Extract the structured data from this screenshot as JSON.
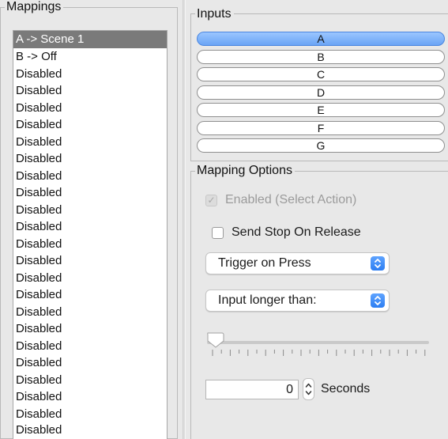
{
  "mappings": {
    "title": "Mappings",
    "items": [
      "A -> Scene 1",
      "B -> Off",
      "Disabled",
      "Disabled",
      "Disabled",
      "Disabled",
      "Disabled",
      "Disabled",
      "Disabled",
      "Disabled",
      "Disabled",
      "Disabled",
      "Disabled",
      "Disabled",
      "Disabled",
      "Disabled",
      "Disabled",
      "Disabled",
      "Disabled",
      "Disabled",
      "Disabled",
      "Disabled",
      "Disabled",
      "Disabled"
    ],
    "selected_index": 0
  },
  "inputs": {
    "title": "Inputs",
    "items": [
      "A",
      "B",
      "C",
      "D",
      "E",
      "F",
      "G"
    ],
    "selected_index": 0
  },
  "options": {
    "title": "Mapping Options",
    "enabled_label": "Enabled (Select Action)",
    "enabled_checked": true,
    "enabled_disabled": true,
    "send_stop_label": "Send Stop On Release",
    "send_stop_checked": false,
    "trigger_select": "Trigger on Press",
    "duration_select": "Input longer than:",
    "slider_value": 0,
    "seconds_value": "0",
    "seconds_label": "Seconds"
  },
  "colors": {
    "selection_gray": "#7a7a7a",
    "selection_blue": "#6aa4f5",
    "accent_blue": "#2d7ef2"
  },
  "icons": {
    "select_arrow": "up-down-chevron-icon",
    "stepper": "stepper-icon",
    "checkmark": "checkmark-icon"
  }
}
